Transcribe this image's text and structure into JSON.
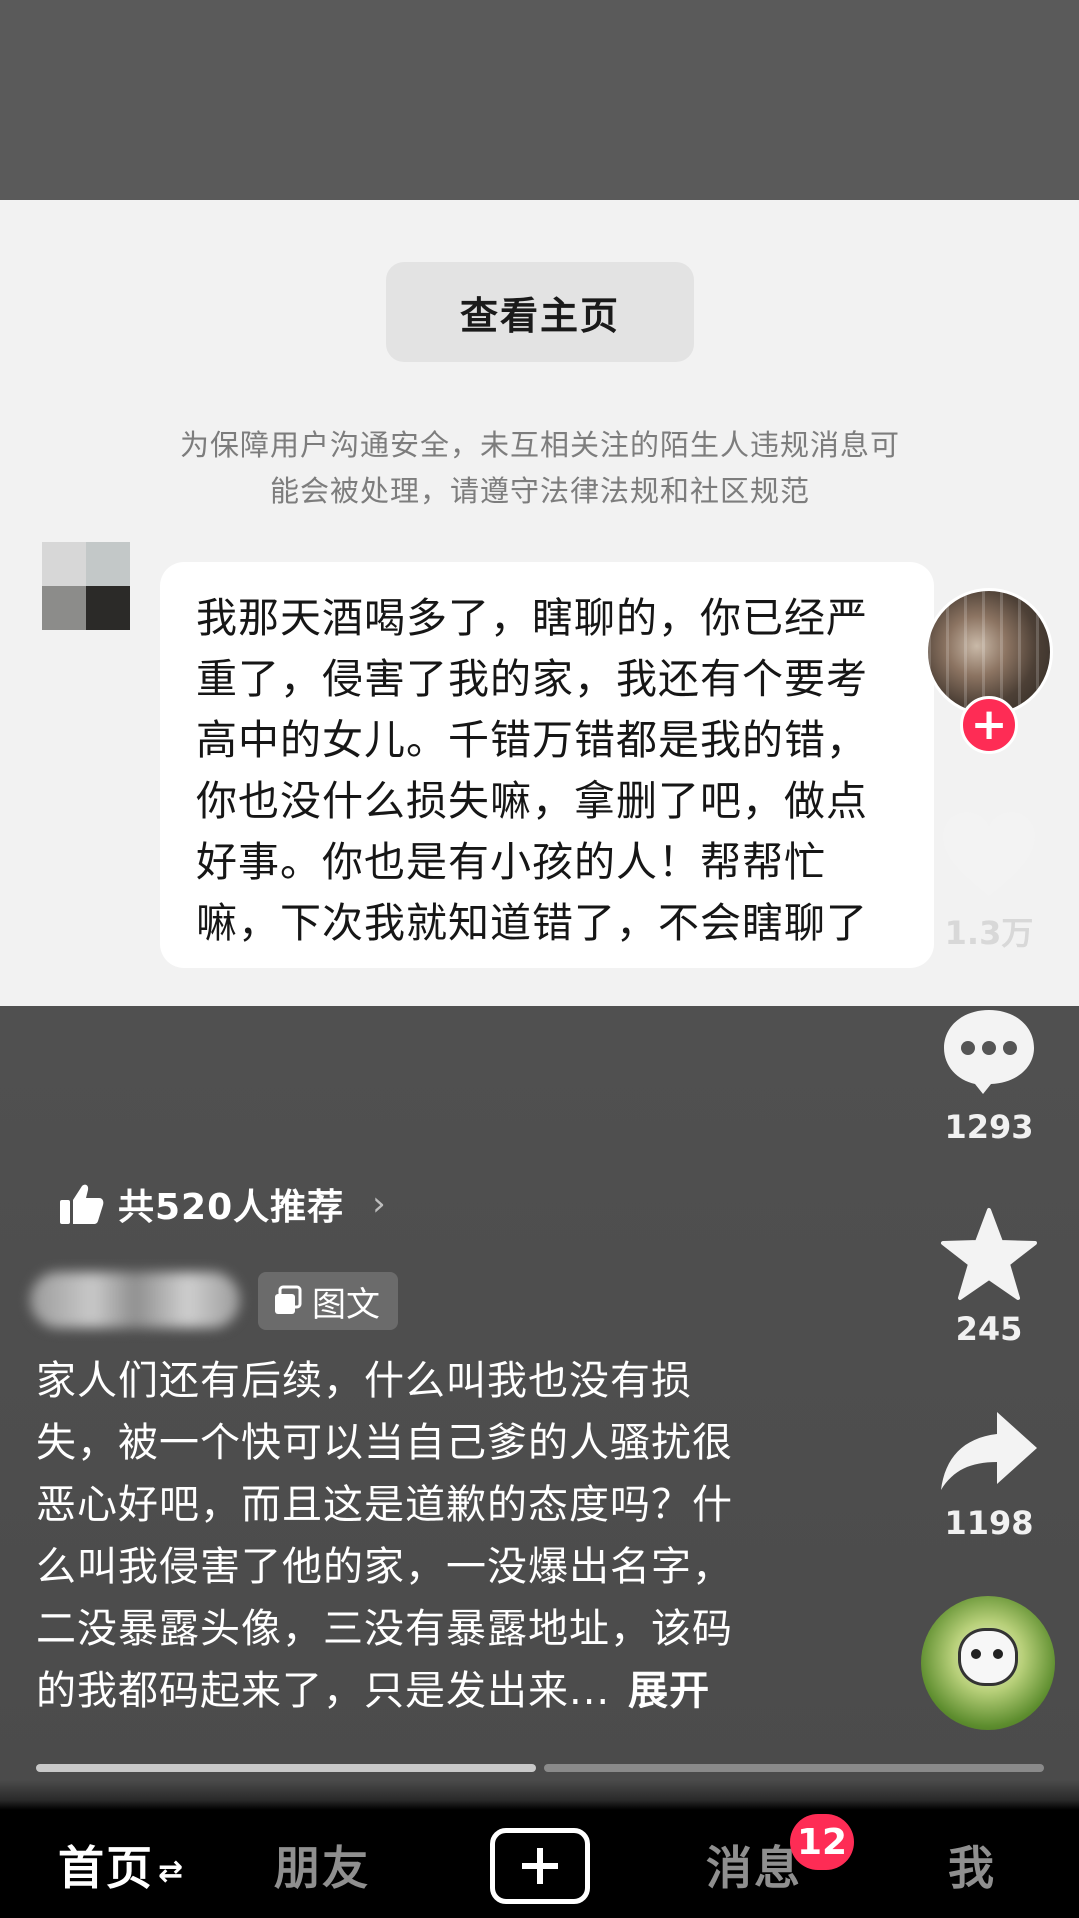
{
  "chat": {
    "view_home_button": "查看主页",
    "safety_notice_line1": "为保障用户沟通安全，未互相关注的陌生人违规消息可",
    "safety_notice_line2": "能会被处理，请遵守法律法规和社区规范",
    "message_lines": [
      "我那天酒喝多了，瞎聊的，你已经严",
      "重了，侵害了我的家，我还有个要考",
      "高中的女儿。千错万错都是我的错，",
      "你也没什么损失嘛，拿删了吧，做点",
      "好事。你也是有小孩的人！帮帮忙",
      "嘛，下次我就知道错了，不会瞎聊了"
    ]
  },
  "rail": {
    "follow_symbol": "+",
    "like_count": "1.3万",
    "comment_count": "1293",
    "favorite_count": "245",
    "share_count": "1198"
  },
  "post": {
    "recommend_text": "共520人推荐",
    "recommend_chevron": "›",
    "type_badge": "图文",
    "caption_lines": [
      "家人们还有后续，什么叫我也没有损",
      "失，被一个快可以当自己爹的人骚扰很",
      "恶心好吧，而且这是道歉的态度吗？什",
      "么叫我侵害了他的家，一没爆出名字，",
      "二没暴露头像，三没有暴露地址，该码",
      "的我都码起来了，只是发出来..."
    ],
    "expand_label": "展开",
    "progress": [
      1.0,
      0.0
    ]
  },
  "nav": {
    "home": "首页",
    "home_swap_icon": "⇄",
    "friends": "朋友",
    "messages": "消息",
    "messages_badge": "12",
    "me": "我"
  },
  "colors": {
    "accent": "#fe2c55",
    "chat_background": "#f2f2f2",
    "bubble": "#ffffff",
    "nav_background": "#000000"
  },
  "icons": [
    "thumbs-up-icon",
    "chevron-right-icon",
    "image-text-icon",
    "heart-icon",
    "comment-icon",
    "star-icon",
    "share-icon",
    "plus-icon",
    "swap-icon",
    "music-disc-icon"
  ]
}
